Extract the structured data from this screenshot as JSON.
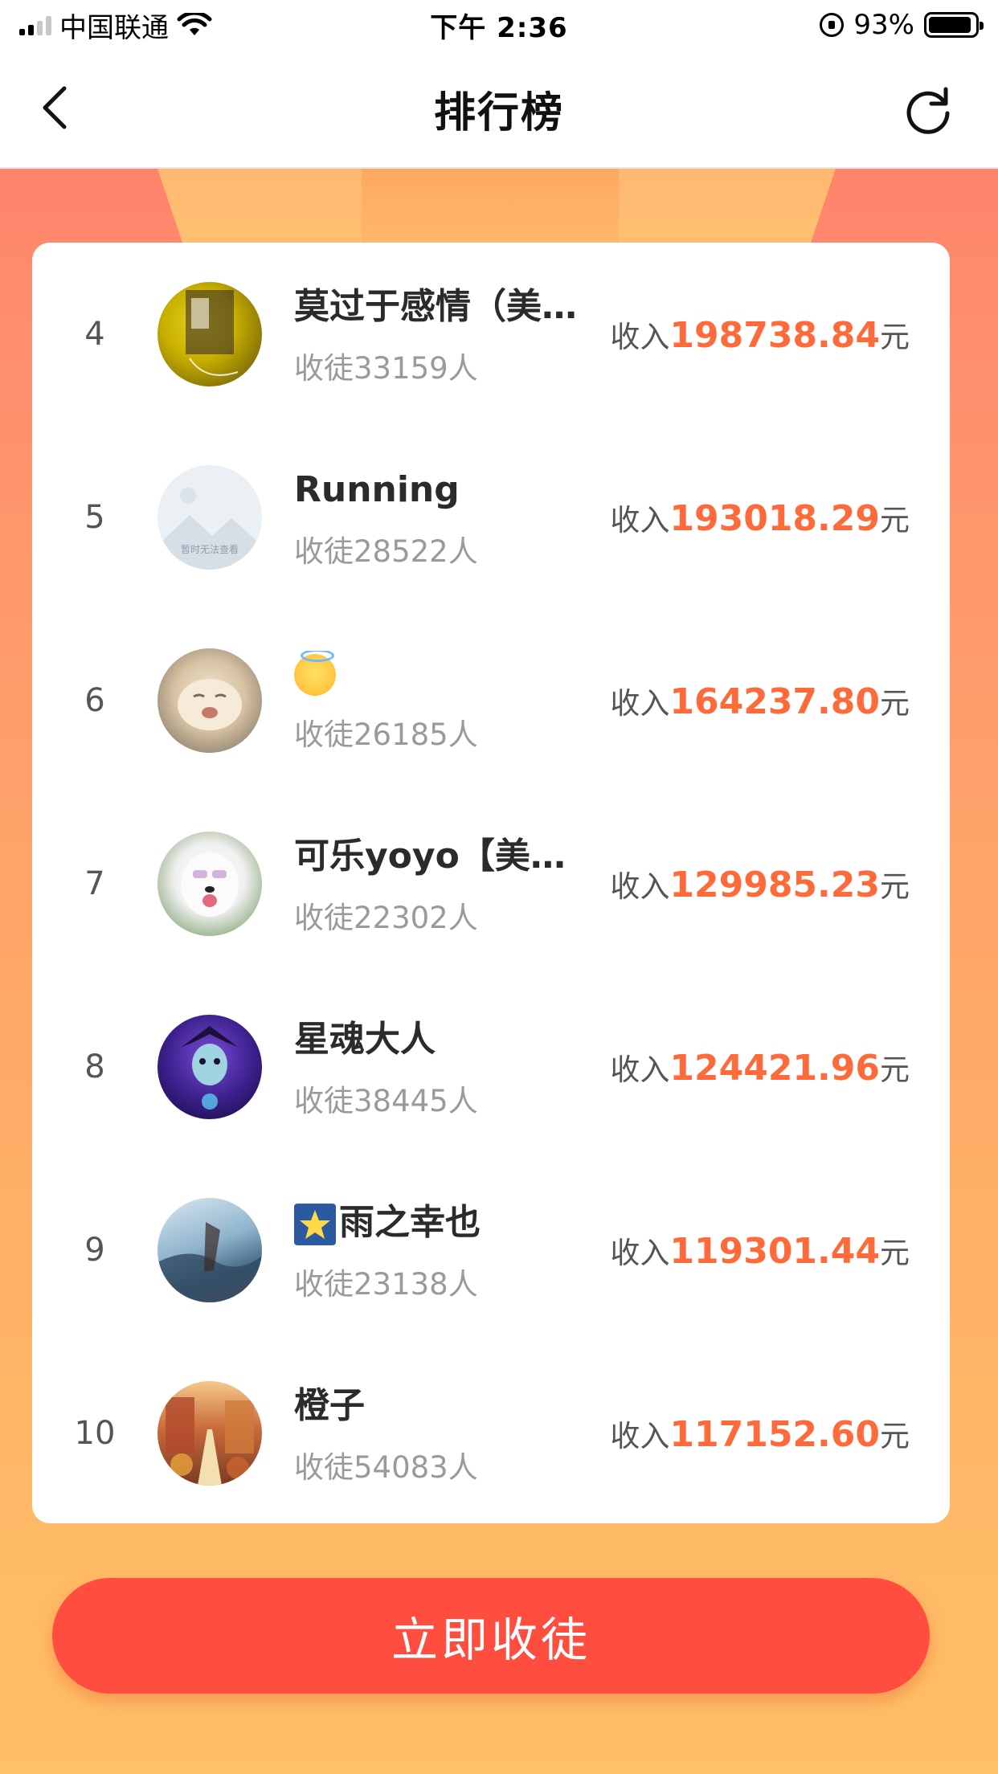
{
  "status_bar": {
    "carrier": "中国联通",
    "time": "下午 2:36",
    "battery": "93%",
    "battery_level": 0.93
  },
  "nav": {
    "title": "排行榜"
  },
  "ranking": [
    {
      "rank": "4",
      "name": "莫过于感情（美…",
      "followers": "收徒33159人",
      "income_prefix": "收入",
      "income_value": "198738.84",
      "income_unit": "元"
    },
    {
      "rank": "5",
      "name": "Running",
      "followers": "收徒28522人",
      "income_prefix": "收入",
      "income_value": "193018.29",
      "income_unit": "元",
      "avatar_placeholder": "暂时无法查看"
    },
    {
      "rank": "6",
      "name": "",
      "followers": "收徒26185人",
      "income_prefix": "收入",
      "income_value": "164237.80",
      "income_unit": "元"
    },
    {
      "rank": "7",
      "name": "可乐yoyo【美逛…",
      "followers": "收徒22302人",
      "income_prefix": "收入",
      "income_value": "129985.23",
      "income_unit": "元"
    },
    {
      "rank": "8",
      "name": "星魂大人",
      "followers": "收徒38445人",
      "income_prefix": "收入",
      "income_value": "124421.96",
      "income_unit": "元"
    },
    {
      "rank": "9",
      "name": "雨之幸也",
      "followers": "收徒23138人",
      "income_prefix": "收入",
      "income_value": "119301.44",
      "income_unit": "元"
    },
    {
      "rank": "10",
      "name": "橙子",
      "followers": "收徒54083人",
      "income_prefix": "收入",
      "income_value": "117152.60",
      "income_unit": "元"
    }
  ],
  "cta": {
    "label": "立即收徒"
  },
  "colors": {
    "accent_orange": "#ff6a3a",
    "cta_red": "#ff4d3f"
  }
}
